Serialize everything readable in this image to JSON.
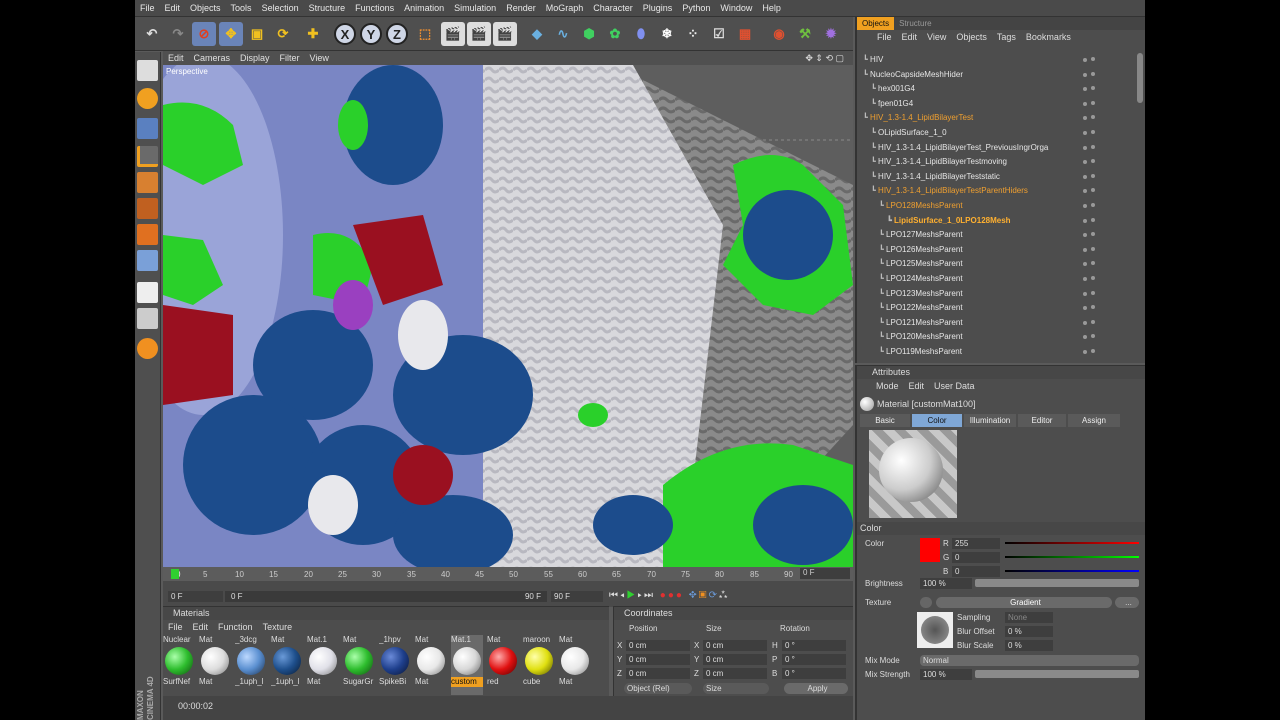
{
  "menu": [
    "File",
    "Edit",
    "Objects",
    "Tools",
    "Selection",
    "Structure",
    "Functions",
    "Animation",
    "Simulation",
    "Render",
    "MoGraph",
    "Character",
    "Plugins",
    "Python",
    "Window",
    "Help"
  ],
  "viewport": {
    "menu": [
      "Edit",
      "Cameras",
      "Display",
      "Filter",
      "View"
    ],
    "label": "Perspective"
  },
  "timeline": {
    "ticks": [
      "0",
      "5",
      "10",
      "15",
      "20",
      "25",
      "30",
      "35",
      "40",
      "45",
      "50",
      "55",
      "60",
      "65",
      "70",
      "75",
      "80",
      "85",
      "90"
    ],
    "frame_end_label": "0 F",
    "start_field": "0 F",
    "range_start": "0 F",
    "range_end": "90 F",
    "end_field": "90 F"
  },
  "materials": {
    "title": "Materials",
    "menu": [
      "File",
      "Edit",
      "Function",
      "Texture"
    ],
    "items": [
      {
        "name": "Nuclear",
        "sub": "SurfNef",
        "color": "#2dbd2d"
      },
      {
        "name": "Mat",
        "sub": "Mat",
        "color": "#e8e8e8"
      },
      {
        "name": "_3dcg",
        "sub": "_1uph_l",
        "color": "#5a8fd0"
      },
      {
        "name": "Mat",
        "sub": "_1uph_l",
        "color": "#1e4f8c"
      },
      {
        "name": "Mat.1",
        "sub": "Mat",
        "color": "#e0e0e8"
      },
      {
        "name": "Mat",
        "sub": "SugarGr",
        "color": "#2dbd2d"
      },
      {
        "name": "_1hpv",
        "sub": "SpikeBi",
        "color": "#1e3f8c"
      },
      {
        "name": "Mat",
        "sub": "Mat",
        "color": "#e8e8e8"
      },
      {
        "name": "Mat.1",
        "sub": "custom",
        "color": "#d8d8d8"
      },
      {
        "name": "Mat",
        "sub": "red",
        "color": "#e01010"
      },
      {
        "name": "maroon",
        "sub": "cube",
        "color": "#e0e010"
      },
      {
        "name": "Mat",
        "sub": "Mat",
        "color": "#e8e8e8"
      }
    ]
  },
  "coordinates": {
    "title": "Coordinates",
    "headers": [
      "Position",
      "Size",
      "Rotation"
    ],
    "rows": [
      {
        "axis": "X",
        "pos": "0 cm",
        "saxis": "X",
        "size": "0 cm",
        "raxis": "H",
        "rot": "0 °"
      },
      {
        "axis": "Y",
        "pos": "0 cm",
        "saxis": "Y",
        "size": "0 cm",
        "raxis": "P",
        "rot": "0 °"
      },
      {
        "axis": "Z",
        "pos": "0 cm",
        "saxis": "Z",
        "size": "0 cm",
        "raxis": "B",
        "rot": "0 °"
      }
    ],
    "mode": "Object (Rel)",
    "size_mode": "Size",
    "apply": "Apply"
  },
  "status": {
    "time": "00:00:02"
  },
  "objects_panel": {
    "tabs": [
      "Objects",
      "Structure"
    ],
    "menu": [
      "File",
      "Edit",
      "View",
      "Objects",
      "Tags",
      "Bookmarks"
    ],
    "rows": [
      {
        "name": "HIV",
        "indent": 0,
        "style": ""
      },
      {
        "name": "NucleoCapsideMeshHider",
        "indent": 0,
        "style": ""
      },
      {
        "name": "hex001G4",
        "indent": 1,
        "style": ""
      },
      {
        "name": "fpen01G4",
        "indent": 1,
        "style": ""
      },
      {
        "name": "HIV_1.3-1.4_LipidBilayerTest",
        "indent": 0,
        "style": "sel"
      },
      {
        "name": "OLipidSurface_1_0",
        "indent": 1,
        "style": ""
      },
      {
        "name": "HIV_1.3-1.4_LipidBilayerTest_PreviousIngrOrga",
        "indent": 1,
        "style": ""
      },
      {
        "name": "HIV_1.3-1.4_LipidBilayerTestmoving",
        "indent": 1,
        "style": ""
      },
      {
        "name": "HIV_1.3-1.4_LipidBilayerTeststatic",
        "indent": 1,
        "style": ""
      },
      {
        "name": "HIV_1.3-1.4_LipidBilayerTestParentHiders",
        "indent": 1,
        "style": "sel"
      },
      {
        "name": "LPO128MeshsParent",
        "indent": 2,
        "style": "sel"
      },
      {
        "name": "LipidSurface_1_0LPO128Mesh",
        "indent": 3,
        "style": "hi"
      },
      {
        "name": "LPO127MeshsParent",
        "indent": 2,
        "style": ""
      },
      {
        "name": "LPO126MeshsParent",
        "indent": 2,
        "style": ""
      },
      {
        "name": "LPO125MeshsParent",
        "indent": 2,
        "style": ""
      },
      {
        "name": "LPO124MeshsParent",
        "indent": 2,
        "style": ""
      },
      {
        "name": "LPO123MeshsParent",
        "indent": 2,
        "style": ""
      },
      {
        "name": "LPO122MeshsParent",
        "indent": 2,
        "style": ""
      },
      {
        "name": "LPO121MeshsParent",
        "indent": 2,
        "style": ""
      },
      {
        "name": "LPO120MeshsParent",
        "indent": 2,
        "style": ""
      },
      {
        "name": "LPO119MeshsParent",
        "indent": 2,
        "style": ""
      }
    ]
  },
  "attributes": {
    "title": "Attributes",
    "menu": [
      "Mode",
      "Edit",
      "User Data"
    ],
    "material": "Material [customMat100]",
    "tabs": [
      "Basic",
      "Color",
      "Illumination",
      "Editor",
      "Assign"
    ],
    "active_tab": "Color",
    "section": "Color",
    "color_label": "Color",
    "swatch": "#ff0000",
    "r_label": "R",
    "r": "255",
    "g_label": "G",
    "g": "0",
    "b_label": "B",
    "b": "0",
    "brightness_label": "Brightness",
    "brightness": "100 %",
    "texture_label": "Texture",
    "texture": "Gradient",
    "texture_more": "...",
    "sampling_label": "Sampling",
    "sampling": "None",
    "blur_offset_label": "Blur Offset",
    "blur_offset": "0 %",
    "blur_scale_label": "Blur Scale",
    "blur_scale": "0 %",
    "mix_mode_label": "Mix Mode",
    "mix_mode": "Normal",
    "mix_strength_label": "Mix Strength",
    "mix_strength": "100 %"
  },
  "brand": {
    "line1": "MAXON",
    "line2": "CINEMA 4D"
  }
}
